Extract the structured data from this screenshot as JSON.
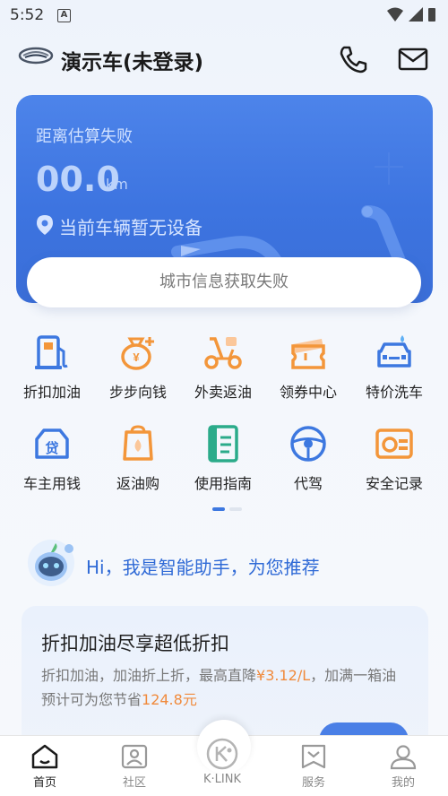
{
  "status_bar": {
    "time": "5:52",
    "notification_letter": "A"
  },
  "header": {
    "title": "演示车(未登录)"
  },
  "trip_card": {
    "label": "距离估算失败",
    "distance": "00.0",
    "unit": "km",
    "device_status": "当前车辆暂无设备",
    "city_status": "城市信息获取失败"
  },
  "services": [
    {
      "label": "折扣加油",
      "icon": "fuel-pump-icon"
    },
    {
      "label": "步步向钱",
      "icon": "money-bag-icon"
    },
    {
      "label": "外卖返油",
      "icon": "scooter-icon"
    },
    {
      "label": "领券中心",
      "icon": "coupon-icon"
    },
    {
      "label": "特价洗车",
      "icon": "car-wash-icon"
    },
    {
      "label": "车主用钱",
      "icon": "loan-icon"
    },
    {
      "label": "返油购",
      "icon": "oil-shopping-icon"
    },
    {
      "label": "使用指南",
      "icon": "guide-book-icon"
    },
    {
      "label": "代驾",
      "icon": "steering-wheel-icon"
    },
    {
      "label": "安全记录",
      "icon": "dashcam-icon"
    }
  ],
  "assistant": {
    "greeting": "Hi，我是智能助手，为您推荐"
  },
  "promo": {
    "title": "折扣加油尽享超低折扣",
    "desc_part1": "折扣加油，加油折上折，最高直降",
    "desc_highlight1": "¥3.12/L",
    "desc_part2": "，加满一箱油预计可为您节省",
    "desc_highlight2": "124.8元"
  },
  "nav": {
    "home": "首页",
    "community": "社区",
    "klink": "K·LINK",
    "service": "服务",
    "mine": "我的"
  },
  "colors": {
    "accent": "#3d74e0",
    "highlight": "#f08a3c",
    "icon_blue": "#3d78e0",
    "icon_orange": "#f3963a"
  }
}
